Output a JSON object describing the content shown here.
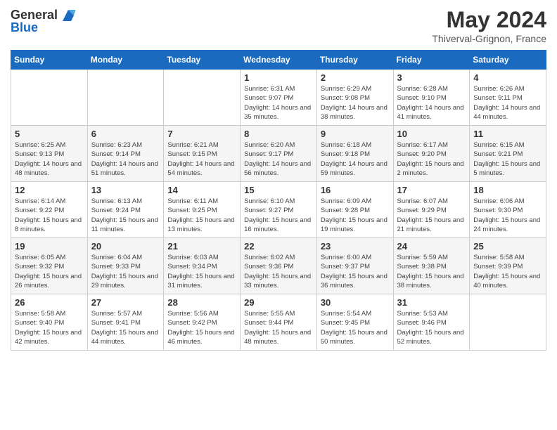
{
  "header": {
    "logo_general": "General",
    "logo_blue": "Blue",
    "month_title": "May 2024",
    "location": "Thiverval-Grignon, France"
  },
  "days_of_week": [
    "Sunday",
    "Monday",
    "Tuesday",
    "Wednesday",
    "Thursday",
    "Friday",
    "Saturday"
  ],
  "weeks": [
    [
      {
        "day": "",
        "info": ""
      },
      {
        "day": "",
        "info": ""
      },
      {
        "day": "",
        "info": ""
      },
      {
        "day": "1",
        "info": "Sunrise: 6:31 AM\nSunset: 9:07 PM\nDaylight: 14 hours\nand 35 minutes."
      },
      {
        "day": "2",
        "info": "Sunrise: 6:29 AM\nSunset: 9:08 PM\nDaylight: 14 hours\nand 38 minutes."
      },
      {
        "day": "3",
        "info": "Sunrise: 6:28 AM\nSunset: 9:10 PM\nDaylight: 14 hours\nand 41 minutes."
      },
      {
        "day": "4",
        "info": "Sunrise: 6:26 AM\nSunset: 9:11 PM\nDaylight: 14 hours\nand 44 minutes."
      }
    ],
    [
      {
        "day": "5",
        "info": "Sunrise: 6:25 AM\nSunset: 9:13 PM\nDaylight: 14 hours\nand 48 minutes."
      },
      {
        "day": "6",
        "info": "Sunrise: 6:23 AM\nSunset: 9:14 PM\nDaylight: 14 hours\nand 51 minutes."
      },
      {
        "day": "7",
        "info": "Sunrise: 6:21 AM\nSunset: 9:15 PM\nDaylight: 14 hours\nand 54 minutes."
      },
      {
        "day": "8",
        "info": "Sunrise: 6:20 AM\nSunset: 9:17 PM\nDaylight: 14 hours\nand 56 minutes."
      },
      {
        "day": "9",
        "info": "Sunrise: 6:18 AM\nSunset: 9:18 PM\nDaylight: 14 hours\nand 59 minutes."
      },
      {
        "day": "10",
        "info": "Sunrise: 6:17 AM\nSunset: 9:20 PM\nDaylight: 15 hours\nand 2 minutes."
      },
      {
        "day": "11",
        "info": "Sunrise: 6:15 AM\nSunset: 9:21 PM\nDaylight: 15 hours\nand 5 minutes."
      }
    ],
    [
      {
        "day": "12",
        "info": "Sunrise: 6:14 AM\nSunset: 9:22 PM\nDaylight: 15 hours\nand 8 minutes."
      },
      {
        "day": "13",
        "info": "Sunrise: 6:13 AM\nSunset: 9:24 PM\nDaylight: 15 hours\nand 11 minutes."
      },
      {
        "day": "14",
        "info": "Sunrise: 6:11 AM\nSunset: 9:25 PM\nDaylight: 15 hours\nand 13 minutes."
      },
      {
        "day": "15",
        "info": "Sunrise: 6:10 AM\nSunset: 9:27 PM\nDaylight: 15 hours\nand 16 minutes."
      },
      {
        "day": "16",
        "info": "Sunrise: 6:09 AM\nSunset: 9:28 PM\nDaylight: 15 hours\nand 19 minutes."
      },
      {
        "day": "17",
        "info": "Sunrise: 6:07 AM\nSunset: 9:29 PM\nDaylight: 15 hours\nand 21 minutes."
      },
      {
        "day": "18",
        "info": "Sunrise: 6:06 AM\nSunset: 9:30 PM\nDaylight: 15 hours\nand 24 minutes."
      }
    ],
    [
      {
        "day": "19",
        "info": "Sunrise: 6:05 AM\nSunset: 9:32 PM\nDaylight: 15 hours\nand 26 minutes."
      },
      {
        "day": "20",
        "info": "Sunrise: 6:04 AM\nSunset: 9:33 PM\nDaylight: 15 hours\nand 29 minutes."
      },
      {
        "day": "21",
        "info": "Sunrise: 6:03 AM\nSunset: 9:34 PM\nDaylight: 15 hours\nand 31 minutes."
      },
      {
        "day": "22",
        "info": "Sunrise: 6:02 AM\nSunset: 9:36 PM\nDaylight: 15 hours\nand 33 minutes."
      },
      {
        "day": "23",
        "info": "Sunrise: 6:00 AM\nSunset: 9:37 PM\nDaylight: 15 hours\nand 36 minutes."
      },
      {
        "day": "24",
        "info": "Sunrise: 5:59 AM\nSunset: 9:38 PM\nDaylight: 15 hours\nand 38 minutes."
      },
      {
        "day": "25",
        "info": "Sunrise: 5:58 AM\nSunset: 9:39 PM\nDaylight: 15 hours\nand 40 minutes."
      }
    ],
    [
      {
        "day": "26",
        "info": "Sunrise: 5:58 AM\nSunset: 9:40 PM\nDaylight: 15 hours\nand 42 minutes."
      },
      {
        "day": "27",
        "info": "Sunrise: 5:57 AM\nSunset: 9:41 PM\nDaylight: 15 hours\nand 44 minutes."
      },
      {
        "day": "28",
        "info": "Sunrise: 5:56 AM\nSunset: 9:42 PM\nDaylight: 15 hours\nand 46 minutes."
      },
      {
        "day": "29",
        "info": "Sunrise: 5:55 AM\nSunset: 9:44 PM\nDaylight: 15 hours\nand 48 minutes."
      },
      {
        "day": "30",
        "info": "Sunrise: 5:54 AM\nSunset: 9:45 PM\nDaylight: 15 hours\nand 50 minutes."
      },
      {
        "day": "31",
        "info": "Sunrise: 5:53 AM\nSunset: 9:46 PM\nDaylight: 15 hours\nand 52 minutes."
      },
      {
        "day": "",
        "info": ""
      }
    ]
  ]
}
